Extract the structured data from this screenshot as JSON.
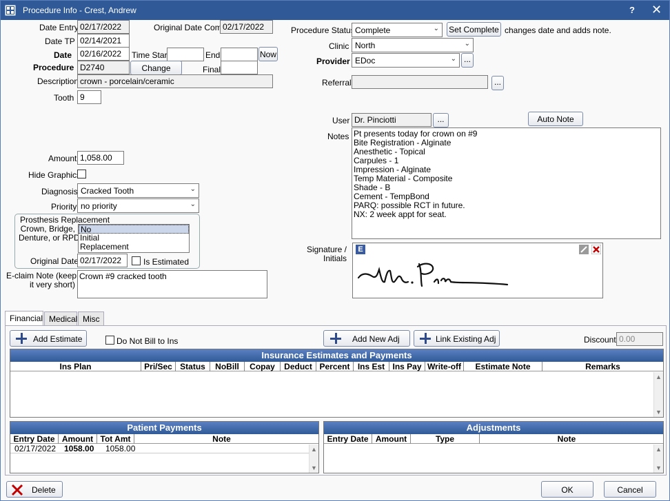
{
  "window": {
    "title": "Procedure Info - Crest, Andrew",
    "help": "?",
    "close": "✕"
  },
  "left": {
    "date_entry_label": "Date Entry",
    "date_entry": "02/17/2022",
    "orig_date_comp_label": "Original Date Comp",
    "orig_date_comp": "02/17/2022",
    "date_tp_label": "Date TP",
    "date_tp": "02/14/2021",
    "date_label": "Date",
    "date": "02/16/2022",
    "time_start_label": "Time Start",
    "time_start": "",
    "end_label": "End",
    "end": "",
    "now_label": "Now",
    "procedure_label": "Procedure",
    "procedure": "D2740",
    "change_label": "Change",
    "final_label": "Final",
    "final": "",
    "description_label": "Description",
    "description": "crown - porcelain/ceramic",
    "tooth_label": "Tooth",
    "tooth": "9",
    "amount_label": "Amount",
    "amount": "1,058.00",
    "hide_graphics_label": "Hide Graphics",
    "diagnosis_label": "Diagnosis",
    "diagnosis": "Cracked Tooth",
    "priority_label": "Priority",
    "priority": "no priority",
    "prosthesis_title": "Prosthesis Replacement",
    "prosthesis_label_1": "Crown, Bridge,",
    "prosthesis_label_2": "Denture, or RPD",
    "prosthesis_options": [
      "No",
      "Initial",
      "Replacement"
    ],
    "original_date_label": "Original Date",
    "original_date": "02/17/2022",
    "is_estimated_label": "Is Estimated",
    "eclaim_label_1": "E-claim Note (keep",
    "eclaim_label_2": "it very short)",
    "eclaim_note": "Crown #9 cracked tooth"
  },
  "right": {
    "status_label": "Procedure Status",
    "status": "Complete",
    "set_complete_label": "Set Complete",
    "set_complete_note": "changes date and adds note.",
    "clinic_label": "Clinic",
    "clinic": "North",
    "provider_label": "Provider",
    "provider": "EDoc",
    "ellipsis": "...",
    "referral_label": "Referral",
    "referral": "",
    "user_label": "User",
    "user": "Dr. Pinciotti",
    "auto_note_label": "Auto Note",
    "notes_label": "Notes",
    "notes": [
      "Pt presents today for crown on #9",
      "Bite Registration - Alginate",
      "Anesthetic - Topical",
      "Carpules - 1",
      "Impression - Alginate",
      "Temp Material - Composite",
      "Shade - B",
      "Cement - TempBond",
      "PARQ: possible RCT in future.",
      "NX: 2 week appt for seat."
    ],
    "signature_label_1": "Signature /",
    "signature_label_2": "Initials",
    "sig_e": "E"
  },
  "tabs": [
    "Financial",
    "Medical",
    "Misc"
  ],
  "financial": {
    "add_estimate_label": "Add Estimate",
    "do_not_bill_label": "Do Not Bill to Ins",
    "add_new_adj_label": "Add New Adj",
    "link_existing_adj_label": "Link Existing Adj",
    "discount_label": "Discount",
    "discount": "0.00",
    "ins_title": "Insurance Estimates and Payments",
    "ins_columns": [
      "Ins Plan",
      "Pri/Sec",
      "Status",
      "NoBill",
      "Copay",
      "Deduct",
      "Percent",
      "Ins Est",
      "Ins Pay",
      "Write-off",
      "Estimate Note",
      "Remarks"
    ],
    "pp_title": "Patient Payments",
    "pp_columns": [
      "Entry Date",
      "Amount",
      "Tot Amt",
      "Note"
    ],
    "pp_rows": [
      {
        "entry_date": "02/17/2022",
        "amount": "1058.00",
        "tot_amt": "1058.00",
        "note": ""
      }
    ],
    "adj_title": "Adjustments",
    "adj_columns": [
      "Entry Date",
      "Amount",
      "Type",
      "Note"
    ]
  },
  "footer": {
    "delete_label": "Delete",
    "ok_label": "OK",
    "cancel_label": "Cancel"
  },
  "colors": {
    "titlebar": "#2f5a97",
    "grid_header": "#2f5a97",
    "delete_x": "#c00000"
  }
}
